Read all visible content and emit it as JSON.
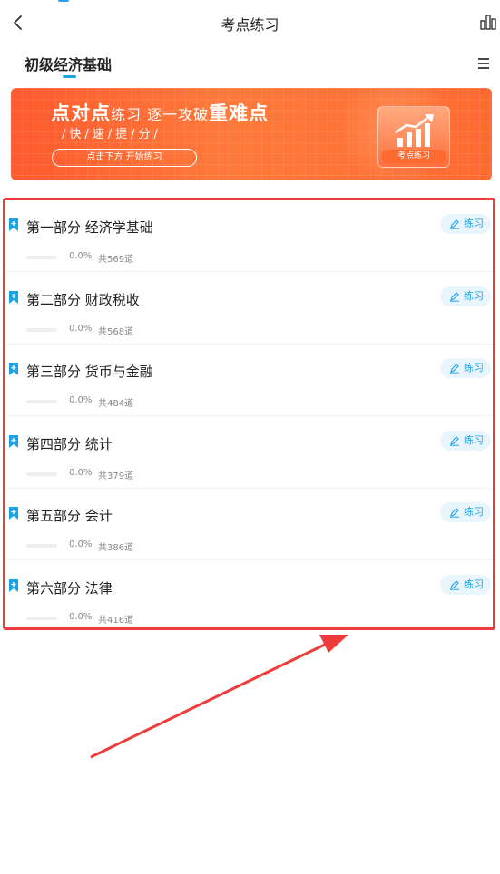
{
  "nav": {
    "title": "考点练习",
    "back_icon": "chevron-left-icon",
    "right_icon": "bar-chart-icon"
  },
  "subject": {
    "title": "初级经济基础",
    "menu_icon": "menu-icon"
  },
  "banner": {
    "headline_a": "点对点",
    "headline_b": "练习 ",
    "headline_c": "逐一攻破",
    "headline_d": "重难点",
    "subtitle": "/快/速/提/分/",
    "button_label": "点击下方 开始练习",
    "card_label": "考点练习"
  },
  "items": [
    {
      "name": "第一部分 经济学基础",
      "progress_text": "0.0%",
      "progress": 0.0,
      "count": "共569道",
      "button": "练习"
    },
    {
      "name": "第二部分 财政税收",
      "progress_text": "0.0%",
      "progress": 0.0,
      "count": "共568道",
      "button": "练习"
    },
    {
      "name": "第三部分 货币与金融",
      "progress_text": "0.0%",
      "progress": 0.0,
      "count": "共484道",
      "button": "练习"
    },
    {
      "name": "第四部分 统计",
      "progress_text": "0.0%",
      "progress": 0.0,
      "count": "共379道",
      "button": "练习"
    },
    {
      "name": "第五部分 会计",
      "progress_text": "0.0%",
      "progress": 0.0,
      "count": "共386道",
      "button": "练习"
    },
    {
      "name": "第六部分 法律",
      "progress_text": "0.0%",
      "progress": 0.0,
      "count": "共416道",
      "button": "练习"
    }
  ],
  "colors": {
    "accent": "#1aa3e8",
    "highlight_box": "#ee3c3c",
    "banner": "#ff6a30"
  }
}
